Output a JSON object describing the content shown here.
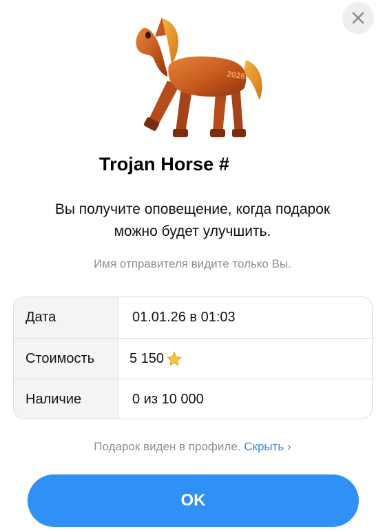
{
  "gift": {
    "title": "Trojan Horse #",
    "image_icon": "trojan-horse-gift",
    "emblem_text": "2026",
    "description_line1": "Вы получите оповещение, когда подарок",
    "description_line2": "можно будет улучшить.",
    "sender_note": "Имя отправителя видите только Вы."
  },
  "details": {
    "date_label": "Дата",
    "date_value": "01.01.26 в 01:03",
    "price_label": "Стоимость",
    "price_value": "5 150",
    "price_icon": "star-icon",
    "availability_label": "Наличие",
    "availability_value": "0 из 10 000"
  },
  "footer": {
    "visibility_text": "Подарок виден в профиле.",
    "hide_link": "Скрыть"
  },
  "actions": {
    "ok_label": "OK",
    "close_icon": "close-icon"
  },
  "colors": {
    "accent": "#2f91f5",
    "link": "#2a8bf2",
    "muted_text": "#8e8e93",
    "horse": "#c4581c"
  }
}
